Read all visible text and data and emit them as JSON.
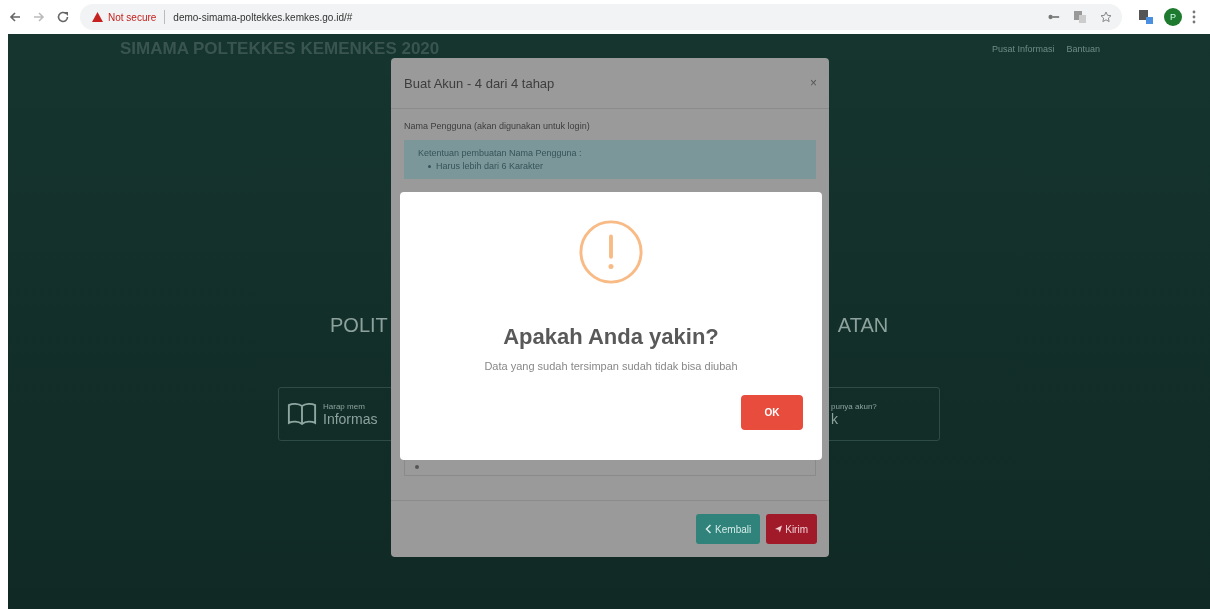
{
  "browser": {
    "security": "Not secure",
    "url": "demo-simama-poltekkes.kemkes.go.id/#",
    "profile_initial": "P"
  },
  "navbar": {
    "brand": "SIMAMA POLTEKKES KEMENKES 2020",
    "links": [
      "Pusat Informasi",
      "Bantuan"
    ]
  },
  "hero": {
    "title_left": "POLIT",
    "title_right": "ATAN"
  },
  "cards": [
    {
      "hint": "Harap mem",
      "label": "Informas"
    },
    {
      "hint": "punya akun?",
      "label": "k"
    }
  ],
  "modal": {
    "title": "Buat Akun - 4 dari 4 tahap",
    "close": "×",
    "field_label": "Nama Pengguna (akan digunakan untuk login)",
    "rules_title": "Ketentuan pembuatan Nama Pengguna :",
    "rules": [
      "Harus lebih dari 6 Karakter"
    ],
    "buttons": [
      {
        "kind": "back",
        "label": "Kembali"
      },
      {
        "kind": "submit",
        "label": "Kirim"
      }
    ]
  },
  "alert": {
    "title": "Apakah Anda yakin?",
    "text": "Data yang sudah tersimpan sudah tidak bisa diubah",
    "confirm": "OK"
  }
}
